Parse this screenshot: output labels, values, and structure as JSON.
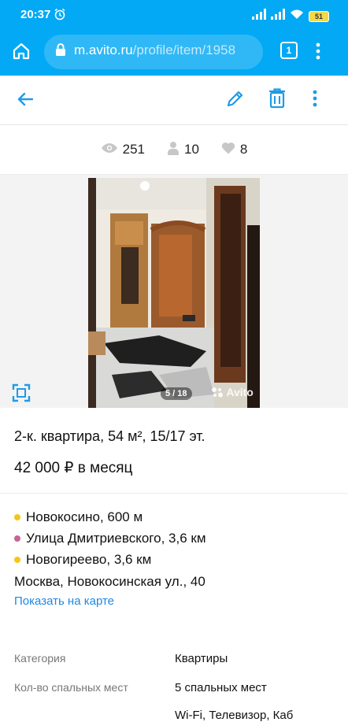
{
  "status_bar": {
    "time": "20:37",
    "battery": "51"
  },
  "browser": {
    "url_host": "m.avito.ru",
    "url_path": "/profile/item/1958",
    "tab_count": "1"
  },
  "stats": {
    "views": "251",
    "contacts": "10",
    "favorites": "8"
  },
  "gallery": {
    "counter": "5 / 18",
    "watermark": "Avito"
  },
  "listing": {
    "title": "2-к. квартира, 54 м², 15/17 эт.",
    "price": "42 000 ₽ в месяц",
    "metro": [
      {
        "name": "Новокосино, 600 м",
        "color": "#f5c518"
      },
      {
        "name": "Улица Дмитриевского, 3,6 км",
        "color": "#c7649c"
      },
      {
        "name": "Новогиреево, 3,6 км",
        "color": "#f5c518"
      }
    ],
    "address": "Москва, Новокосинская ул., 40",
    "map_link": "Показать на карте"
  },
  "params": [
    {
      "label": "Категория",
      "value": "Квартиры"
    },
    {
      "label": "Кол-во спальных мест",
      "value": "5 спальных мест"
    },
    {
      "label": "",
      "value": "Wi-Fi, Телевизор, Каб"
    }
  ],
  "colors": {
    "accent": "#03a9f4",
    "link": "#1e88e5"
  }
}
